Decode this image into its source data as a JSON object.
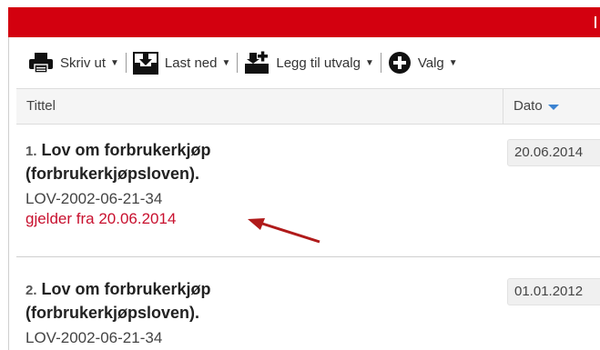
{
  "toolbar": {
    "print_label": "Skriv ut",
    "download_label": "Last ned",
    "add_selection_label": "Legg til utvalg",
    "options_label": "Valg"
  },
  "table": {
    "columns": {
      "title": "Tittel",
      "date": "Dato"
    },
    "rows": [
      {
        "number": "1.",
        "title_line1": "Lov om forbrukerkjøp",
        "title_line2": "(forbrukerkjøpsloven).",
        "id": "LOV-2002-06-21-34",
        "valid_from": "gjelder fra 20.06.2014",
        "date": "20.06.2014"
      },
      {
        "number": "2.",
        "title_line1": "Lov om forbrukerkjøp",
        "title_line2": "(forbrukerkjøpsloven).",
        "id": "LOV-2002-06-21-34",
        "date": "01.01.2012"
      }
    ]
  },
  "colors": {
    "brand_bar": "#d3000f",
    "highlight_text": "#c8102e",
    "annotation_arrow": "#b01a1a",
    "sort_arrow": "#3b83d1"
  },
  "icons": [
    "printer-icon",
    "download-icon",
    "add-to-selection-icon",
    "plus-circle-icon",
    "caret-down-icon",
    "sort-desc-icon"
  ]
}
